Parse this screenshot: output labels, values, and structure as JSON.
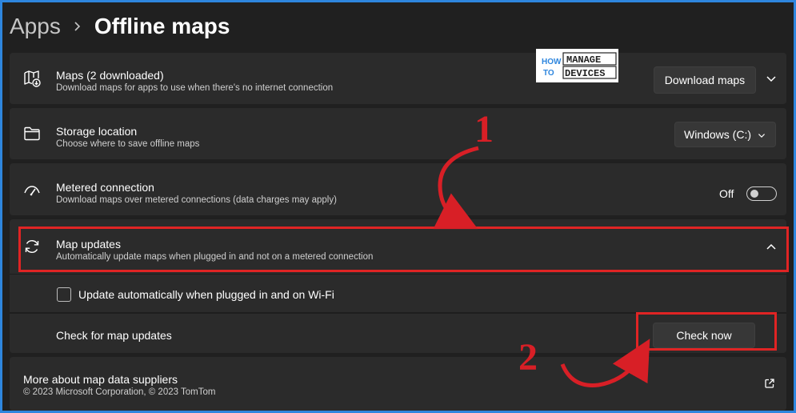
{
  "breadcrumb": {
    "parent": "Apps",
    "current": "Offline maps"
  },
  "logo": {
    "line1": "HOW TO",
    "line2": "MANAGE",
    "line3": "DEVICES"
  },
  "maps": {
    "title": "Maps (2 downloaded)",
    "subtitle": "Download maps for apps to use when there's no internet connection",
    "button": "Download maps"
  },
  "storage": {
    "title": "Storage location",
    "subtitle": "Choose where to save offline maps",
    "selected": "Windows (C:)"
  },
  "metered": {
    "title": "Metered connection",
    "subtitle": "Download maps over metered connections (data charges may apply)",
    "state_label": "Off"
  },
  "updates": {
    "title": "Map updates",
    "subtitle": "Automatically update maps when plugged in and not on a metered connection",
    "auto_label": "Update automatically when plugged in and on Wi-Fi",
    "check_label": "Check for map updates",
    "check_button": "Check now"
  },
  "footer": {
    "title": "More about map data suppliers",
    "copyright": "© 2023 Microsoft Corporation, © 2023 TomTom"
  },
  "annotations": {
    "step1": "1",
    "step2": "2"
  },
  "colors": {
    "background": "#202020",
    "card": "#2b2b2b",
    "highlight": "#e02424",
    "frame": "#2e86de"
  }
}
